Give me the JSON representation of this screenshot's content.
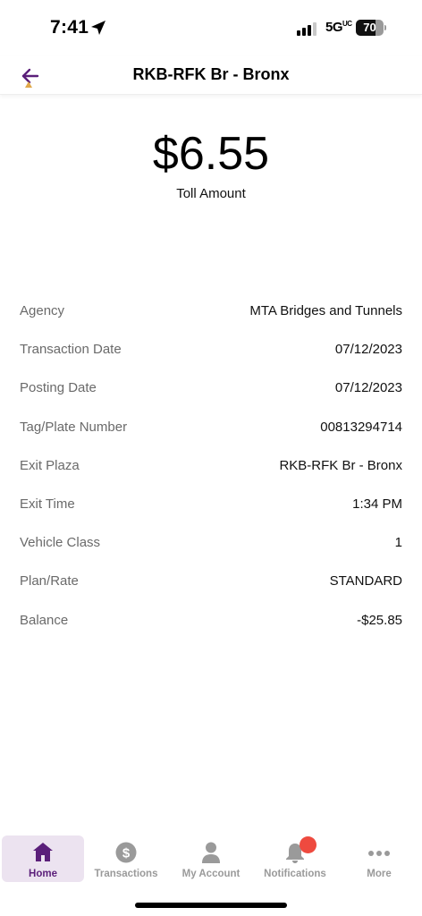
{
  "status_bar": {
    "time": "7:41",
    "network": "5G",
    "network_superscript": "UC",
    "battery": "70",
    "battery_level": 0.7
  },
  "header": {
    "title": "RKB-RFK Br - Bronx",
    "back_icon": "back-arrow-icon",
    "accent_color": "#5b1f7a"
  },
  "toll": {
    "amount": "$6.55",
    "label": "Toll Amount"
  },
  "details": [
    {
      "label": "Agency",
      "value": "MTA Bridges and Tunnels"
    },
    {
      "label": "Transaction Date",
      "value": "07/12/2023"
    },
    {
      "label": "Posting Date",
      "value": "07/12/2023"
    },
    {
      "label": "Tag/Plate Number",
      "value": "00813294714"
    },
    {
      "label": "Exit Plaza",
      "value": "RKB-RFK Br - Bronx"
    },
    {
      "label": "Exit Time",
      "value": "1:34 PM"
    },
    {
      "label": "Vehicle Class",
      "value": "1"
    },
    {
      "label": "Plan/Rate",
      "value": "STANDARD"
    },
    {
      "label": "Balance",
      "value": "-$25.85"
    }
  ],
  "nav": {
    "items": [
      {
        "label": "Home",
        "icon": "home-icon",
        "active": true
      },
      {
        "label": "Transactions",
        "icon": "dollar-circle-icon",
        "active": false
      },
      {
        "label": "My Account",
        "icon": "person-icon",
        "active": false
      },
      {
        "label": "Notifications",
        "icon": "bell-icon",
        "active": false,
        "badge": true
      },
      {
        "label": "More",
        "icon": "more-dots-icon",
        "active": false
      }
    ],
    "active_color": "#5b1f7a",
    "inactive_color": "#9a9a9a",
    "badge_color": "#ee4a3f"
  }
}
